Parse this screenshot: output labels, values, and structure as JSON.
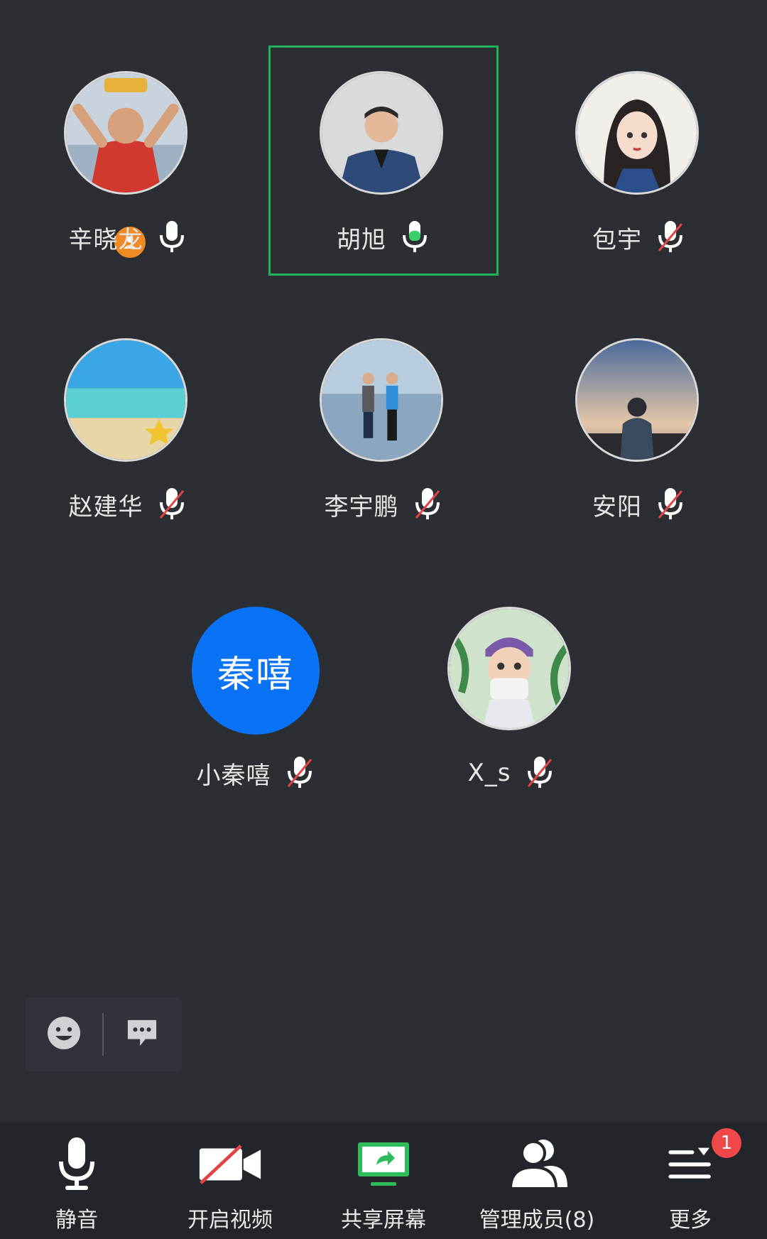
{
  "participants": [
    {
      "name": "辛晓龙",
      "mic": "on",
      "host": true
    },
    {
      "name": "胡旭",
      "mic": "speaking",
      "active": true
    },
    {
      "name": "包宇",
      "mic": "muted"
    },
    {
      "name": "赵建华",
      "mic": "muted"
    },
    {
      "name": "李宇鹏",
      "mic": "muted"
    },
    {
      "name": "安阳",
      "mic": "muted"
    },
    {
      "name": "小秦嘻",
      "mic": "muted",
      "avatar_text": "秦嘻"
    },
    {
      "name": "X_s",
      "mic": "muted"
    }
  ],
  "chat_bar": {
    "emoji_icon": "emoji-icon",
    "message_icon": "message-icon"
  },
  "toolbar": {
    "mute_label": "静音",
    "video_label": "开启视频",
    "share_label": "共享屏幕",
    "members_label": "管理成员(8)",
    "more_label": "更多",
    "more_badge": "1"
  },
  "colors": {
    "background": "#2b2e33",
    "toolbar": "#22252a",
    "speaking_frame": "#1fb35a",
    "text_avatar": "#0a72f5",
    "badge": "#f04848"
  }
}
